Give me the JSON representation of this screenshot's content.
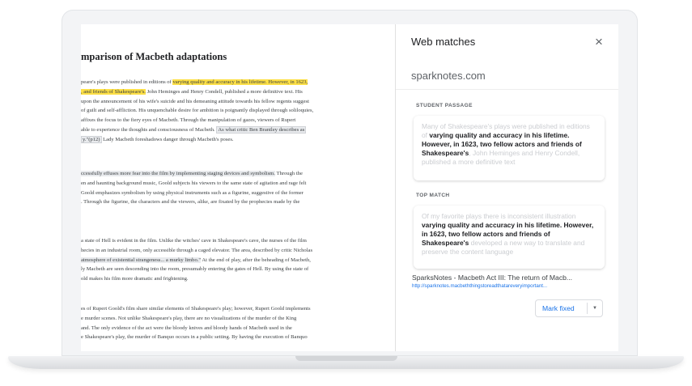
{
  "document": {
    "title": "mparison of Macbeth adaptations",
    "paragraphs": [
      {
        "lines": [
          {
            "pre": "peare's plays were published in editions of ",
            "y": "varying quality and accuracy in his lifetime. However, in 1623,",
            "post": ""
          },
          {
            "pre": "",
            "y": ", and friends of Shakespeare's.",
            "post": " John Heminges and Henry Condell, published a more definitive text. His"
          },
          {
            "pre": "upon the announcement of his wife's suicide and his demeaning attitude towards his fellow regents suggest",
            "y": "",
            "post": ""
          },
          {
            "pre": "of guilt and self-affliction. His unquenchable desire for ambition is poignantly displayed through soliloquies,",
            "y": "",
            "post": ""
          },
          {
            "pre": "affixes the focus to the fiery eyes of Macbeth. Through the manipulation of gazes, viewers of Rupert",
            "y": "",
            "post": ""
          },
          {
            "pre": "able to experience the thoughts and consciousness of Macbeth. ",
            "box": "As what critic Ben Brantley describes as",
            "post": ""
          },
          {
            "pre": "",
            "box": "y.\"(p12)",
            "post": " Lady Macbeth foreshadows danger through Macbeth's poses."
          }
        ]
      },
      {
        "lines": [
          {
            "pre": "ccessfully effuses more fear into the film by implementing staging devices and symbolism.",
            "post": " Through the"
          },
          {
            "pre": "en and haunting background music, Goold subjects his viewers to the same state of agitation and rage felt",
            "post": ""
          },
          {
            "pre": "Goold emphasizes symbolism by using physical instruments such as a figurine, suggestive of the former",
            "post": ""
          },
          {
            "pre": ". Through the figurine, the characters and the viewers, alike, are fixated by the prophecies made by the",
            "post": ""
          }
        ]
      },
      {
        "lines": [
          {
            "pre": "a state of Hell is evident in the film. Unlike the witches' cave in Shakespeare's cave, the nurses of the film",
            "post": ""
          },
          {
            "pre": "hecies in an industrial room, only accessible through a caged elevator. The area, described by critic Nicholas",
            "post": ""
          },
          {
            "pre": "atmosphere of existential strangeness... a murky limbo.\"",
            "post": " At the end of play, after the beheading of Macbeth,"
          },
          {
            "pre": "ly Macbeth are seen descending into the room, presumably entering the gates of Hell. By using the state of",
            "post": ""
          },
          {
            "pre": "old makes his film more dramatic and frightening.",
            "post": ""
          }
        ]
      },
      {
        "lines": [
          {
            "pre": "es of Rupert Goold's film share similar elements of Shakespeare's play; however, Rupert Goold implements",
            "post": ""
          },
          {
            "pre": "e murder scenes. Not unlike Shakespeare's play, there are no visualizations of the murder of the King",
            "post": ""
          },
          {
            "pre": "and. The only evidence of the act were the bloody knives and bloody hands of Macbeth used in the",
            "post": ""
          },
          {
            "pre": "e Shakespeare's play, the murder of Banquo occurs in a public setting. By having the execution of Banquo",
            "post": ""
          }
        ]
      }
    ]
  },
  "panel": {
    "title": "Web matches",
    "close_icon": "×",
    "source": "sparknotes.com",
    "student_label": "STUDENT PASSAGE",
    "student_passage": {
      "before": "Many of Shakespeare's plays were published in editions of ",
      "match": "varying quality and accuracy in his lifetime. However, in 1623, two fellow actors and friends of Shakespeare's",
      "after": ", John Heminges and Henry Condell, published a more definitive text"
    },
    "top_label": "TOP MATCH",
    "top_match": {
      "before": "Of my favorite plays there is inconsistent illustration ",
      "match": "varying quality and accuracy in his lifetime. However, in 1623, two fellow actors and friends of Shakespeare's",
      "after": " developed a new way to translate and preserve the content language"
    },
    "result_title": "SparksNotes - Macbeth Act III: The return of Macb...",
    "result_url": "http://sparknotes.macbeththingstoreadthatareveryimportant...",
    "mark_label": "Mark fixed",
    "caret_icon": "▼"
  }
}
